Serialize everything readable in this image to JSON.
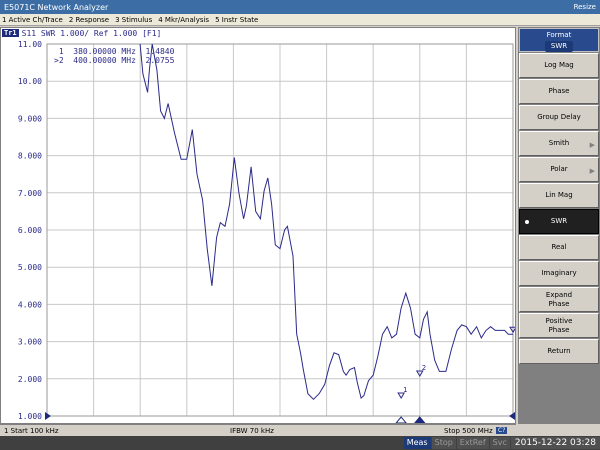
{
  "window": {
    "title": "E5071C Network Analyzer",
    "resize_label": "Resize"
  },
  "menu": [
    "1 Active Ch/Trace",
    "2 Response",
    "3 Stimulus",
    "4 Mkr/Analysis",
    "5 Instr State"
  ],
  "trace": {
    "label": "Tr1",
    "desc": "S11  SWR 1.000/ Ref 1.000 [F1]"
  },
  "markers": [
    {
      "text": " 1  380.00000 MHz  1.4840"
    },
    {
      "text": ">2  400.00000 MHz  2.0755"
    }
  ],
  "chart_data": {
    "type": "line",
    "y_tick_labels": [
      "11.00",
      "10.00",
      "9.000",
      "8.000",
      "7.000",
      "6.000",
      "5.000",
      "4.000",
      "3.000",
      "2.000",
      "1.000"
    ],
    "ylim": [
      1,
      11
    ],
    "xlim_mhz": [
      0.1,
      500
    ],
    "grid": true,
    "series": [
      {
        "color": "#2a2a8a",
        "x": [
          100,
          103,
          108,
          110,
          113,
          118,
          122,
          126,
          130,
          137,
          144,
          150,
          156,
          161,
          167,
          172,
          177,
          182,
          186,
          191,
          196,
          201,
          206,
          211,
          214,
          219,
          224,
          229,
          233,
          237,
          241,
          245,
          250,
          255,
          258,
          264,
          268,
          272,
          275,
          280,
          286,
          292,
          298,
          303,
          308,
          313,
          318,
          321,
          325,
          330,
          333,
          337,
          340,
          345,
          350,
          355,
          360,
          365,
          370,
          375,
          380,
          385,
          390,
          395,
          400,
          404,
          408,
          411,
          416,
          421,
          428,
          434,
          440,
          445,
          450,
          455,
          461,
          466,
          471,
          476,
          481,
          486,
          491,
          495,
          500
        ],
        "y": [
          11,
          10.2,
          9.7,
          10.3,
          11,
          10.3,
          9.2,
          9.0,
          9.4,
          8.6,
          7.9,
          7.9,
          8.7,
          7.5,
          6.8,
          5.5,
          4.5,
          5.8,
          6.2,
          6.1,
          6.7,
          7.95,
          7.0,
          6.3,
          6.65,
          7.7,
          6.5,
          6.3,
          7.05,
          7.4,
          6.7,
          5.6,
          5.5,
          6.0,
          6.1,
          5.3,
          3.2,
          2.7,
          2.25,
          1.6,
          1.45,
          1.6,
          1.85,
          2.35,
          2.7,
          2.65,
          2.2,
          2.1,
          2.25,
          2.3,
          1.9,
          1.48,
          1.55,
          1.95,
          2.1,
          2.6,
          3.2,
          3.4,
          3.1,
          3.2,
          3.9,
          4.3,
          3.9,
          3.2,
          3.1,
          3.6,
          3.8,
          3.2,
          2.5,
          2.2,
          2.2,
          2.8,
          3.3,
          3.45,
          3.4,
          3.2,
          3.4,
          3.1,
          3.3,
          3.4,
          3.3,
          3.3,
          3.3,
          3.2,
          3.2
        ],
        "note": ""
      }
    ]
  },
  "marker_flags": [
    {
      "label": "1",
      "x_mhz": 380,
      "y": 1.484
    },
    {
      "label": "2",
      "x_mhz": 400,
      "y": 2.0755
    },
    {
      "label": "1",
      "x_mhz": 500,
      "y": 3.25
    }
  ],
  "sidebar": {
    "title": "Format",
    "subtitle": "SWR",
    "buttons": [
      {
        "label": "Log Mag"
      },
      {
        "label": "Phase"
      },
      {
        "label": "Group Delay"
      },
      {
        "label": "Smith"
      },
      {
        "label": "Polar"
      },
      {
        "label": "Lin Mag"
      },
      {
        "label": "SWR"
      },
      {
        "label": "Real"
      },
      {
        "label": "Imaginary"
      },
      {
        "label": "Expand\nPhase"
      },
      {
        "label": "Positive\nPhase"
      },
      {
        "label": "Return"
      }
    ]
  },
  "status": {
    "start": "1  Start 100 kHz",
    "ifbw": "IFBW 70 kHz",
    "stop": "Stop 500 MHz",
    "cont": "C?"
  },
  "bottom": {
    "meas": "Meas",
    "stop": "Stop",
    "extref": "ExtRef",
    "svc": "Svc",
    "time": "2015-12-22 03:28"
  }
}
